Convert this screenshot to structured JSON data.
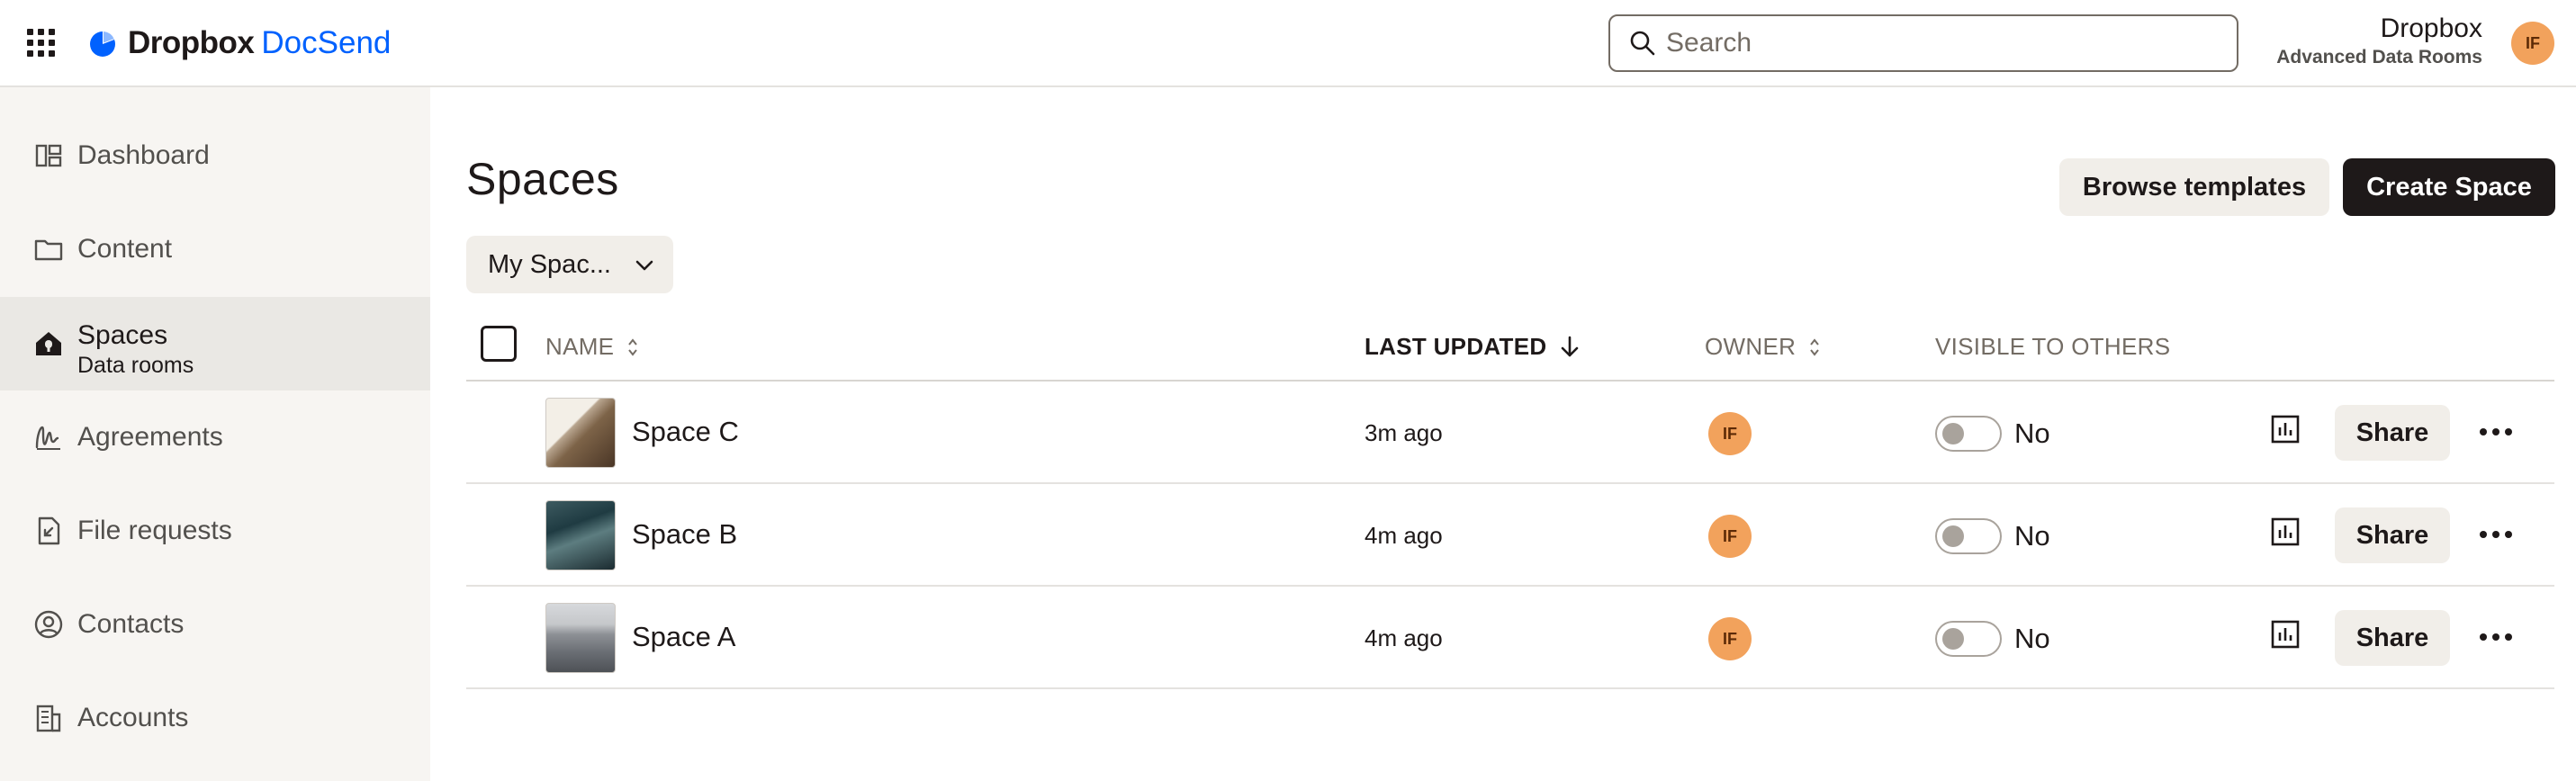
{
  "header": {
    "brand_name": "Dropbox",
    "brand_product": "DocSend",
    "search_placeholder": "Search",
    "account_name": "Dropbox",
    "account_plan": "Advanced Data Rooms",
    "avatar_initials": "IF"
  },
  "sidebar": {
    "items": [
      {
        "label": "Dashboard",
        "icon": "dashboard-icon"
      },
      {
        "label": "Content",
        "icon": "folder-icon"
      },
      {
        "label": "Spaces",
        "sub": "Data rooms",
        "icon": "spaces-home-icon",
        "active": true
      },
      {
        "label": "Agreements",
        "icon": "signature-icon"
      },
      {
        "label": "File requests",
        "icon": "file-request-icon"
      },
      {
        "label": "Contacts",
        "icon": "contact-icon"
      },
      {
        "label": "Accounts",
        "icon": "building-icon"
      }
    ]
  },
  "main": {
    "title": "Spaces",
    "browse_templates": "Browse templates",
    "create_space": "Create Space",
    "filter_label": "My Spac...",
    "columns": {
      "name": "NAME",
      "last_updated": "LAST UPDATED",
      "owner": "OWNER",
      "visible": "VISIBLE TO OTHERS"
    },
    "rows": [
      {
        "name": "Space C",
        "updated": "3m ago",
        "owner": "IF",
        "visible": "No",
        "share": "Share",
        "visible_on": false
      },
      {
        "name": "Space B",
        "updated": "4m ago",
        "owner": "IF",
        "visible": "No",
        "share": "Share",
        "visible_on": false
      },
      {
        "name": "Space A",
        "updated": "4m ago",
        "owner": "IF",
        "visible": "No",
        "share": "Share",
        "visible_on": false
      }
    ]
  },
  "colors": {
    "brand_blue": "#0061fe",
    "avatar_orange": "#f2a25c",
    "primary_button": "#1e1919",
    "sidebar_bg": "#f7f5f2"
  }
}
